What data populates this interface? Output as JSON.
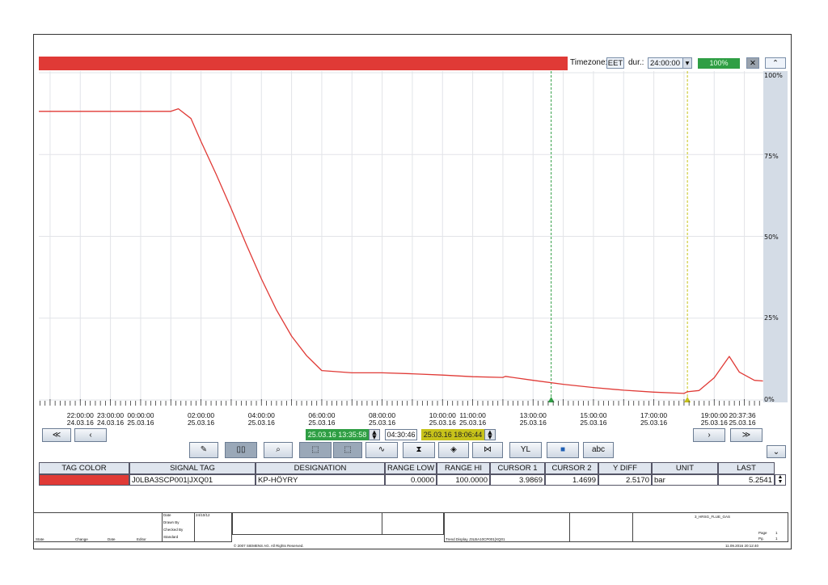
{
  "topbar": {
    "timezone_label": "Timezone:",
    "timezone_value": "EET",
    "dur_label": "dur.:",
    "dur_value": "24:00:00",
    "progress_label": "100%",
    "progress_fraction": 1.0,
    "collapse_glyph": "⌃"
  },
  "colors": {
    "series": "#e03a36",
    "cursor1": "#2f9e44",
    "cursor2": "#c7c21a",
    "bar_green": "#2f9e44"
  },
  "y_axis": {
    "labels": [
      "100%",
      "75%",
      "50%",
      "25%",
      "0%"
    ]
  },
  "chart_data": {
    "type": "line",
    "xlabel": "",
    "ylabel": "",
    "ylim": [
      0,
      100
    ],
    "x_tick_labels": [
      {
        "time": "22:00:00",
        "date": "24.03.16"
      },
      {
        "time": "23:00:00",
        "date": "24.03.16"
      },
      {
        "time": "00:00:00",
        "date": "25.03.16"
      },
      {
        "time": "02:00:00",
        "date": "25.03.16"
      },
      {
        "time": "04:00:00",
        "date": "25.03.16"
      },
      {
        "time": "06:00:00",
        "date": "25.03.16"
      },
      {
        "time": "08:00:00",
        "date": "25.03.16"
      },
      {
        "time": "10:00:00",
        "date": "25.03.16"
      },
      {
        "time": "11:00:00",
        "date": "25.03.16"
      },
      {
        "time": "13:00:00",
        "date": "25.03.16"
      },
      {
        "time": "15:00:00",
        "date": "25.03.16"
      },
      {
        "time": "17:00:00",
        "date": "25.03.16"
      },
      {
        "time": "19:00:00",
        "date": "25.03.16"
      },
      {
        "time": "20:37:36",
        "date": "25.03.16"
      }
    ],
    "series": [
      {
        "name": "J0LBA3SCP001|JXQ01",
        "x": [
          "24.03.16 20:37",
          "24.03.16 22:00",
          "24.03.16 23:00",
          "25.03.16 00:00",
          "25.03.16 01:00",
          "25.03.16 01:15",
          "25.03.16 01:40",
          "25.03.16 02:00",
          "25.03.16 02:30",
          "25.03.16 03:00",
          "25.03.16 03:30",
          "25.03.16 04:00",
          "25.03.16 04:30",
          "25.03.16 05:00",
          "25.03.16 05:30",
          "25.03.16 06:00",
          "25.03.16 07:00",
          "25.03.16 08:00",
          "25.03.16 09:00",
          "25.03.16 10:00",
          "25.03.16 11:00",
          "25.03.16 12:00",
          "25.03.16 12:05",
          "25.03.16 13:00",
          "25.03.16 14:00",
          "25.03.16 15:00",
          "25.03.16 16:00",
          "25.03.16 17:00",
          "25.03.16 18:00",
          "25.03.16 18:06",
          "25.03.16 18:30",
          "25.03.16 19:00",
          "25.03.16 19:30",
          "25.03.16 19:50",
          "25.03.16 20:20",
          "25.03.16 20:37"
        ],
        "values": [
          88.2,
          88.2,
          88.2,
          88.2,
          88.2,
          89.0,
          86.0,
          79.0,
          69.0,
          58.5,
          47.5,
          37.0,
          27.5,
          19.5,
          13.5,
          9.0,
          8.3,
          8.3,
          8.0,
          7.6,
          7.1,
          6.9,
          7.2,
          6.0,
          4.8,
          3.8,
          3.0,
          2.4,
          2.0,
          2.5,
          2.9,
          6.8,
          13.3,
          8.5,
          6.0,
          5.8
        ]
      }
    ]
  },
  "time_controls": {
    "cursor1_time": "25.03.16 13:35:58",
    "diff_time": "04:30:46",
    "cursor2_time": "25.03.16 18:06:44"
  },
  "nav": {
    "first": "≪",
    "prev": "‹",
    "next": "›",
    "last": "≫",
    "expand": "⌄"
  },
  "toolbar": {
    "abc_label": "abc",
    "yl_label": "YL"
  },
  "table": {
    "headers": [
      "TAG COLOR",
      "SIGNAL TAG",
      "DESIGNATION",
      "RANGE LOW",
      "RANGE HI",
      "CURSOR 1",
      "CURSOR 2",
      "Y DIFF",
      "UNIT",
      "LAST"
    ],
    "row": {
      "signal_tag": "J0LBA3SCP001|JXQ01",
      "designation": "KP-HÖYRY",
      "range_low": "0.0000",
      "range_hi": "100.0000",
      "cursor1": "3.9869",
      "cursor2": "1.4699",
      "y_diff": "2.5170",
      "unit": "bar",
      "last": "5.2541"
    }
  },
  "titleblock": {
    "date_label": "Date",
    "date_value": "24/10/12",
    "drawn_by": "Drawn By",
    "checked_by": "Checked By",
    "standard": "Standard",
    "state": "State",
    "change": "Change",
    "date2": "Date",
    "editor": "Editor",
    "copyright": "© 2007 SIEMENS AG. All Rights Reserved.",
    "trend_display": "Trend Display  J3LBA10CP001|XQ01",
    "sheet_name": "3_HRSG_FLUE_GAS",
    "page_label": "Page",
    "page_value": "1",
    "pg_label": "Pg.",
    "pg_value": "1",
    "printed": "11.09.2016 20:12:40"
  }
}
